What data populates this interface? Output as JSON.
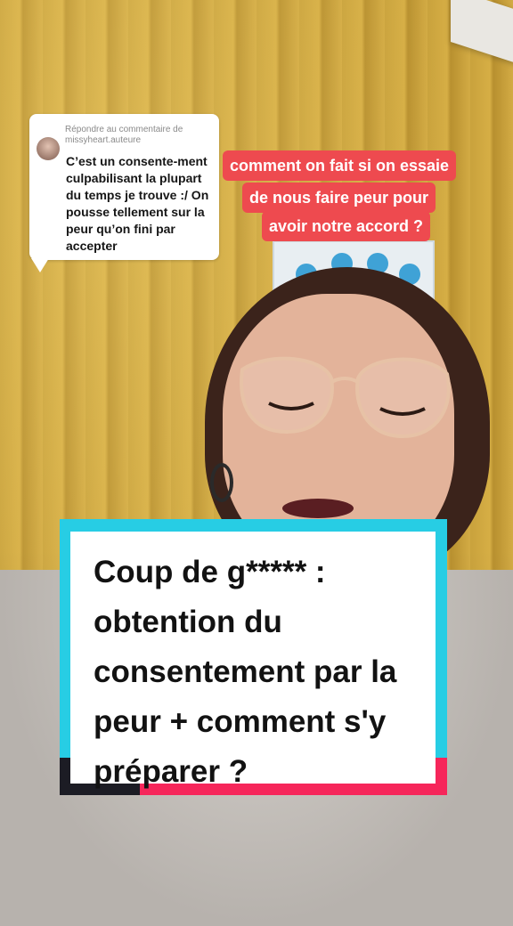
{
  "reply": {
    "header": "Répondre au commentaire de missyheart.auteure",
    "comment": "C’est un consente-ment culpabilisant la plupart du temps je trouve :/ On pousse tellement sur la peur qu’on fini par accepter"
  },
  "captions": [
    "comment on fait si on essaie",
    "de nous faire peur pour",
    "avoir notre accord ?"
  ],
  "title_card": {
    "lines": [
      "Coup de g***** :",
      "obtention du",
      "consentement par la",
      "peur + comment s'y",
      "préparer ?"
    ]
  },
  "colors": {
    "caption_red": "#ee4a4f",
    "title_cyan": "#27cde4",
    "title_pink": "#f6265a",
    "wall_yellow": "#d3ab44"
  }
}
